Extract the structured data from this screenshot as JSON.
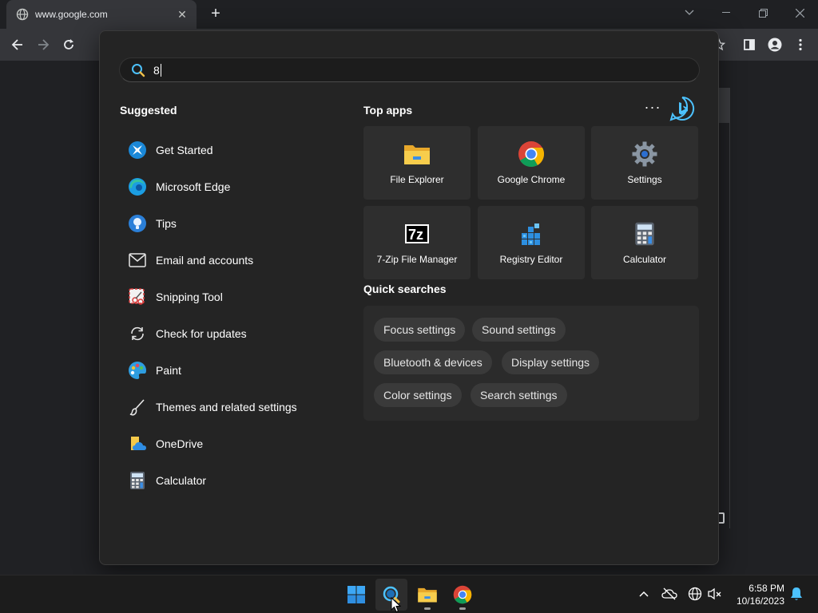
{
  "browser": {
    "tab_title": "www.google.com",
    "tab_close": "✕",
    "new_tab": "+"
  },
  "search": {
    "query": "8"
  },
  "suggested": {
    "title": "Suggested",
    "items": [
      {
        "label": "Get Started",
        "icon": "get-started-icon"
      },
      {
        "label": "Microsoft Edge",
        "icon": "edge-icon"
      },
      {
        "label": "Tips",
        "icon": "tips-icon"
      },
      {
        "label": "Email and accounts",
        "icon": "email-icon"
      },
      {
        "label": "Snipping Tool",
        "icon": "snipping-tool-icon"
      },
      {
        "label": "Check for updates",
        "icon": "refresh-icon"
      },
      {
        "label": "Paint",
        "icon": "paint-icon"
      },
      {
        "label": "Themes and related settings",
        "icon": "brush-icon"
      },
      {
        "label": "OneDrive",
        "icon": "onedrive-icon"
      },
      {
        "label": "Calculator",
        "icon": "calculator-icon"
      }
    ]
  },
  "top_apps": {
    "title": "Top apps",
    "more": "···",
    "apps": [
      {
        "label": "File Explorer",
        "icon": "file-explorer-icon"
      },
      {
        "label": "Google Chrome",
        "icon": "chrome-icon"
      },
      {
        "label": "Settings",
        "icon": "gear-icon"
      },
      {
        "label": "7-Zip File Manager",
        "icon": "7zip-icon"
      },
      {
        "label": "Registry Editor",
        "icon": "registry-editor-icon"
      },
      {
        "label": "Calculator",
        "icon": "calculator-icon"
      }
    ]
  },
  "quick_searches": {
    "title": "Quick searches",
    "chips": [
      "Focus settings",
      "Sound settings",
      "Bluetooth & devices",
      "Display settings",
      "Color settings",
      "Search settings"
    ]
  },
  "taskbar": {
    "time": "6:58 PM",
    "date": "10/16/2023"
  },
  "colors": {
    "accent": "#4cc2ff",
    "panel_bg": "#242424",
    "tile_bg": "#2e2e2e"
  }
}
